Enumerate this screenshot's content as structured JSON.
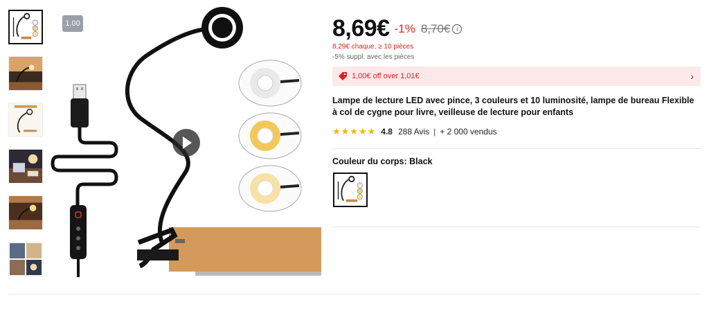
{
  "gallery": {
    "zoom_badge": "1.00",
    "thumbnails": [
      {
        "name": "thumb-lamp-white-bg",
        "active": true
      },
      {
        "name": "thumb-lamp-in-room",
        "active": false
      },
      {
        "name": "thumb-lamp-product-details",
        "active": false
      },
      {
        "name": "thumb-lamp-reading",
        "active": false
      },
      {
        "name": "thumb-lamp-desk-scene",
        "active": false
      },
      {
        "name": "thumb-lamp-collage",
        "active": false
      }
    ],
    "play_icon": "play-icon"
  },
  "product": {
    "price": "8,69€",
    "discount": "-1%",
    "old_price": "8,70€",
    "info_icon": "ⓘ",
    "bulk_price": "8,29€ chaque, ≥ 10 pièces",
    "extra_discount": "-5% suppl. avec les pièces",
    "coupon": "1,00€ off over 1,01€",
    "coupon_chevron": "›",
    "title": "Lampe de lecture LED avec pince, 3 couleurs et 10 luminosité, lampe de bureau Flexible à col de cygne pour livre, veilleuse de lecture pour enfants",
    "stars": "★★★★★",
    "rating": "4.8",
    "reviews": "288 Avis",
    "separator": "|",
    "sold": "+ 2 000 vendus",
    "color_label": "Couleur du corps: Black"
  },
  "colors": {
    "accent_red": "#e02020",
    "coupon_bg": "#fde8ea",
    "star": "#f5b400"
  }
}
